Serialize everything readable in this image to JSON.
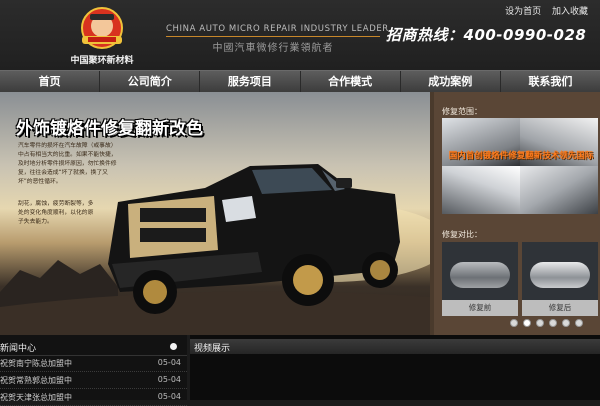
{
  "brand": {
    "logo_text": "中国聚环新材料",
    "slogan_en": "CHINA AUTO MICRO REPAIR INDUSTRY LEADER",
    "slogan_cn": "中國汽車微修行業領航者",
    "hotline": "招商热线：400-0990-028"
  },
  "top_links": [
    "设为首页",
    "加入收藏"
  ],
  "nav": [
    "首页",
    "公司简介",
    "服务项目",
    "合作模式",
    "成功案例",
    "联系我们"
  ],
  "hero": {
    "title": "外饰镀烙件修复翻新改色",
    "desc1": "汽车零件的损坏在汽车故障（或事故）中占有相当大的比重。如果不能快捷，及时地分析零件损坏原因，勿忙换件修复，往往会造成“坏了就换，换了又坏”的恶性循环。",
    "desc2": "刮花，腐蚀，疲劳断裂等，多处的变化角度顺利，以化的原子失去能力。"
  },
  "side": {
    "range_label": "修复范围：",
    "range_caption": "国内首创镀烙件修复翻新技术领先国际",
    "compare_label": "修复对比：",
    "before_label": "修复前",
    "after_label": "修复后",
    "dot_count": 6,
    "active_dot": 1
  },
  "news": {
    "title": "新闻中心",
    "items": [
      {
        "text": "祝贺南宁陈总加盟中",
        "date": "05-04"
      },
      {
        "text": "祝贺常熟郭总加盟中",
        "date": "05-04"
      },
      {
        "text": "祝贺天津张总加盟中",
        "date": "05-04"
      }
    ]
  },
  "video": {
    "title": "视频展示"
  },
  "colors": {
    "header_bg": "#262626",
    "accent_orange": "#ff7a1a",
    "side_bg": "#5a4636",
    "nav_bg": "#4c4c4c"
  }
}
